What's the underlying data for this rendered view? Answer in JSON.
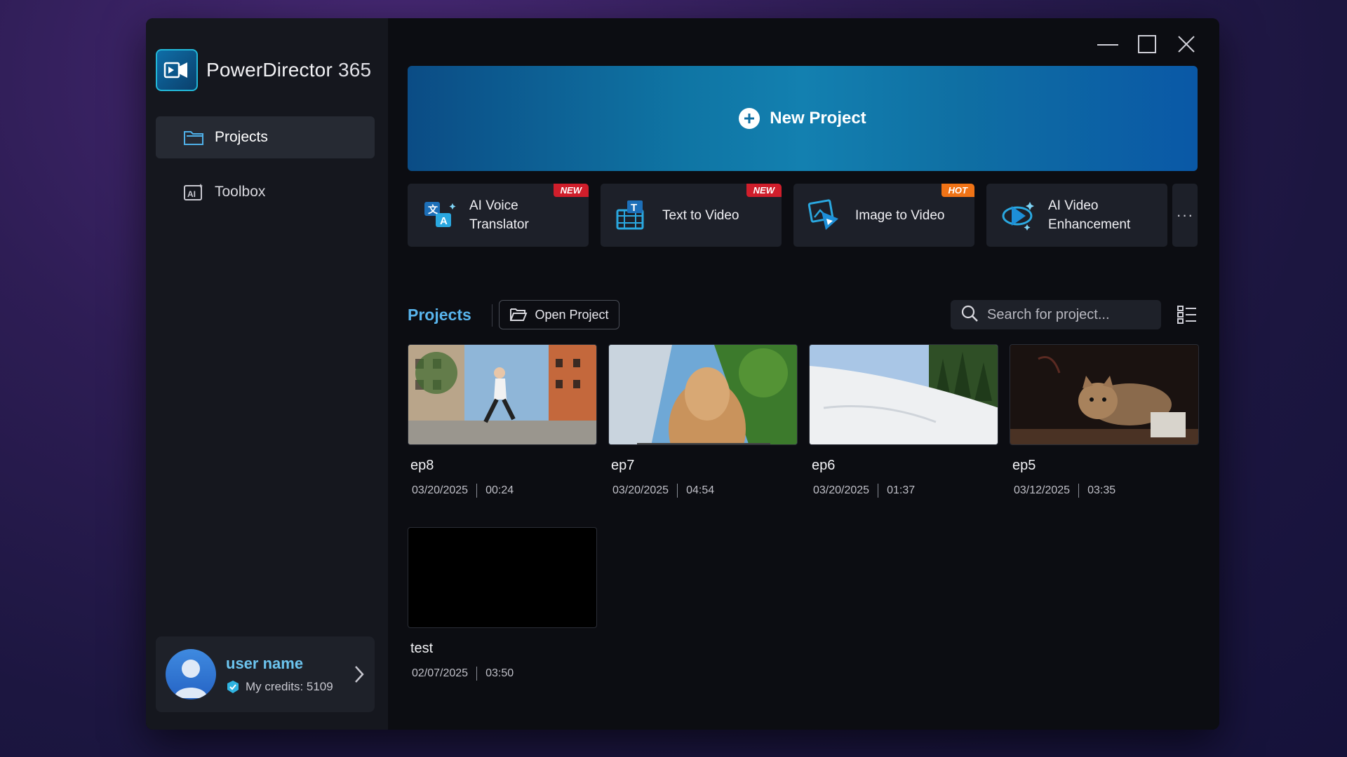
{
  "app": {
    "name": "PowerDirector",
    "version": "365"
  },
  "sidebar": {
    "items": [
      {
        "label": "Projects",
        "active": true
      },
      {
        "label": "Toolbox",
        "active": false
      }
    ]
  },
  "user": {
    "name": "user name",
    "credits_text": "My credits: 5109"
  },
  "new_project": {
    "label": "New Project"
  },
  "tools": [
    {
      "label_line1": "AI Voice",
      "label_line2": "Translator",
      "badge": "NEW",
      "icon": "ai-voice-translator-icon"
    },
    {
      "label_line1": "Text to Video",
      "label_line2": "",
      "badge": "NEW",
      "icon": "text-to-video-icon"
    },
    {
      "label_line1": "Image to Video",
      "label_line2": "",
      "badge": "HOT",
      "icon": "image-to-video-icon"
    },
    {
      "label_line1": "AI Video",
      "label_line2": "Enhancement",
      "badge": "",
      "icon": "ai-video-enhancement-icon"
    }
  ],
  "more_label": "···",
  "projects_section": {
    "title": "Projects",
    "open_label": "Open Project",
    "search_placeholder": "Search for project..."
  },
  "projects": [
    {
      "name": "ep8",
      "date": "03/20/2025",
      "duration": "00:24"
    },
    {
      "name": "ep7",
      "date": "03/20/2025",
      "duration": "04:54"
    },
    {
      "name": "ep6",
      "date": "03/20/2025",
      "duration": "01:37"
    },
    {
      "name": "ep5",
      "date": "03/12/2025",
      "duration": "03:35"
    },
    {
      "name": "test",
      "date": "02/07/2025",
      "duration": "03:50"
    }
  ],
  "colors": {
    "accent": "#58b4ec",
    "badge_new": "#d01e2b",
    "badge_hot": "#f07316",
    "banner_blue": "#0f75a4"
  }
}
